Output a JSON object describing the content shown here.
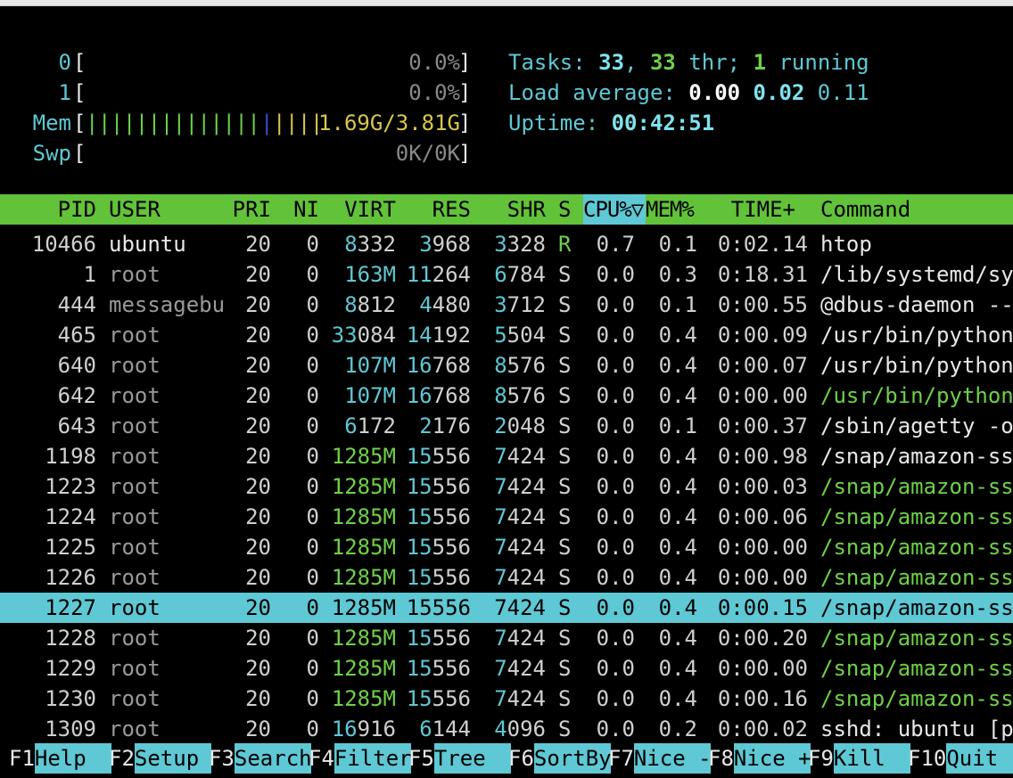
{
  "meters": {
    "cpu0": {
      "label": "0",
      "open": "[",
      "value": "0.0%",
      "close": "]"
    },
    "cpu1": {
      "label": "1",
      "open": "[",
      "value": "0.0%",
      "close": "]"
    },
    "mem": {
      "label": "Mem",
      "open": "[",
      "bars_green": "||||||||||||||",
      "bars_blue": "|",
      "bars_yellow": "||||",
      "value": "1.69G/3.81G",
      "close": "]"
    },
    "swp": {
      "label": "Swp",
      "open": "[",
      "value": "0K/0K",
      "close": "]"
    }
  },
  "info": {
    "tasks_label": "Tasks: ",
    "tasks_count": "33",
    "tasks_sep": ", ",
    "threads_count": "33",
    "threads_label": " thr; ",
    "running_count": "1",
    "running_label": " running",
    "load_label": "Load average: ",
    "load1": "0.00",
    "load5": "0.02",
    "load15": "0.11",
    "uptime_label": "Uptime: ",
    "uptime": "00:42:51"
  },
  "table": {
    "columns": [
      "PID",
      "USER",
      "PRI",
      "NI",
      "VIRT",
      "RES",
      "SHR",
      "S",
      "CPU%▽",
      "MEM%",
      "TIME+",
      "Command"
    ],
    "rows": [
      {
        "pid": "10466",
        "user": "ubuntu",
        "pri": "20",
        "ni": "0",
        "virt": "8332",
        "res": "3968",
        "shr": "3328",
        "s": "R",
        "cpu": "0.7",
        "mem": "0.1",
        "time": "0:02.14",
        "cmd": "htop"
      },
      {
        "pid": "1",
        "user": "root",
        "pri": "20",
        "ni": "0",
        "virt": "163M",
        "res": "11264",
        "shr": "6784",
        "s": "S",
        "cpu": "0.0",
        "mem": "0.3",
        "time": "0:18.31",
        "cmd": "/lib/systemd/sy"
      },
      {
        "pid": "444",
        "user": "messagebu",
        "pri": "20",
        "ni": "0",
        "virt": "8812",
        "res": "4480",
        "shr": "3712",
        "s": "S",
        "cpu": "0.0",
        "mem": "0.1",
        "time": "0:00.55",
        "cmd": "@dbus-daemon --"
      },
      {
        "pid": "465",
        "user": "root",
        "pri": "20",
        "ni": "0",
        "virt": "33084",
        "res": "14192",
        "shr": "5504",
        "s": "S",
        "cpu": "0.0",
        "mem": "0.4",
        "time": "0:00.09",
        "cmd": "/usr/bin/python"
      },
      {
        "pid": "640",
        "user": "root",
        "pri": "20",
        "ni": "0",
        "virt": "107M",
        "res": "16768",
        "shr": "8576",
        "s": "S",
        "cpu": "0.0",
        "mem": "0.4",
        "time": "0:00.07",
        "cmd": "/usr/bin/python"
      },
      {
        "pid": "642",
        "user": "root",
        "pri": "20",
        "ni": "0",
        "virt": "107M",
        "res": "16768",
        "shr": "8576",
        "s": "S",
        "cpu": "0.0",
        "mem": "0.4",
        "time": "0:00.00",
        "cmd": "/usr/bin/python"
      },
      {
        "pid": "643",
        "user": "root",
        "pri": "20",
        "ni": "0",
        "virt": "6172",
        "res": "2176",
        "shr": "2048",
        "s": "S",
        "cpu": "0.0",
        "mem": "0.1",
        "time": "0:00.37",
        "cmd": "/sbin/agetty -o"
      },
      {
        "pid": "1198",
        "user": "root",
        "pri": "20",
        "ni": "0",
        "virt": "1285M",
        "res": "15556",
        "shr": "7424",
        "s": "S",
        "cpu": "0.0",
        "mem": "0.4",
        "time": "0:00.98",
        "cmd": "/snap/amazon-ss"
      },
      {
        "pid": "1223",
        "user": "root",
        "pri": "20",
        "ni": "0",
        "virt": "1285M",
        "res": "15556",
        "shr": "7424",
        "s": "S",
        "cpu": "0.0",
        "mem": "0.4",
        "time": "0:00.03",
        "cmd": "/snap/amazon-ss"
      },
      {
        "pid": "1224",
        "user": "root",
        "pri": "20",
        "ni": "0",
        "virt": "1285M",
        "res": "15556",
        "shr": "7424",
        "s": "S",
        "cpu": "0.0",
        "mem": "0.4",
        "time": "0:00.06",
        "cmd": "/snap/amazon-ss"
      },
      {
        "pid": "1225",
        "user": "root",
        "pri": "20",
        "ni": "0",
        "virt": "1285M",
        "res": "15556",
        "shr": "7424",
        "s": "S",
        "cpu": "0.0",
        "mem": "0.4",
        "time": "0:00.00",
        "cmd": "/snap/amazon-ss"
      },
      {
        "pid": "1226",
        "user": "root",
        "pri": "20",
        "ni": "0",
        "virt": "1285M",
        "res": "15556",
        "shr": "7424",
        "s": "S",
        "cpu": "0.0",
        "mem": "0.4",
        "time": "0:00.00",
        "cmd": "/snap/amazon-ss"
      },
      {
        "pid": "1227",
        "user": "root",
        "pri": "20",
        "ni": "0",
        "virt": "1285M",
        "res": "15556",
        "shr": "7424",
        "s": "S",
        "cpu": "0.0",
        "mem": "0.4",
        "time": "0:00.15",
        "cmd": "/snap/amazon-ss"
      },
      {
        "pid": "1228",
        "user": "root",
        "pri": "20",
        "ni": "0",
        "virt": "1285M",
        "res": "15556",
        "shr": "7424",
        "s": "S",
        "cpu": "0.0",
        "mem": "0.4",
        "time": "0:00.20",
        "cmd": "/snap/amazon-ss"
      },
      {
        "pid": "1229",
        "user": "root",
        "pri": "20",
        "ni": "0",
        "virt": "1285M",
        "res": "15556",
        "shr": "7424",
        "s": "S",
        "cpu": "0.0",
        "mem": "0.4",
        "time": "0:00.00",
        "cmd": "/snap/amazon-ss"
      },
      {
        "pid": "1230",
        "user": "root",
        "pri": "20",
        "ni": "0",
        "virt": "1285M",
        "res": "15556",
        "shr": "7424",
        "s": "S",
        "cpu": "0.0",
        "mem": "0.4",
        "time": "0:00.16",
        "cmd": "/snap/amazon-ss"
      },
      {
        "pid": "1309",
        "user": "root",
        "pri": "20",
        "ni": "0",
        "virt": "16916",
        "res": "6144",
        "shr": "4096",
        "s": "S",
        "cpu": "0.0",
        "mem": "0.2",
        "time": "0:00.02",
        "cmd": "sshd: ubuntu [p"
      }
    ]
  },
  "fkeys": [
    {
      "key": "F1",
      "label": "Help  "
    },
    {
      "key": "F2",
      "label": "Setup "
    },
    {
      "key": "F3",
      "label": "Search"
    },
    {
      "key": "F4",
      "label": "Filter"
    },
    {
      "key": "F5",
      "label": "Tree  "
    },
    {
      "key": "F6",
      "label": "SortBy"
    },
    {
      "key": "F7",
      "label": "Nice -"
    },
    {
      "key": "F8",
      "label": "Nice +"
    },
    {
      "key": "F9",
      "label": "Kill  "
    },
    {
      "key": "F10",
      "label": "Quit  "
    }
  ],
  "colors": {
    "header_bg": "#62c23a",
    "selection_bg": "#5ec8d4",
    "cyan": "#5ec8d4",
    "green": "#6ed148",
    "yellow": "#d8c74a",
    "blue": "#3b4fd8"
  }
}
